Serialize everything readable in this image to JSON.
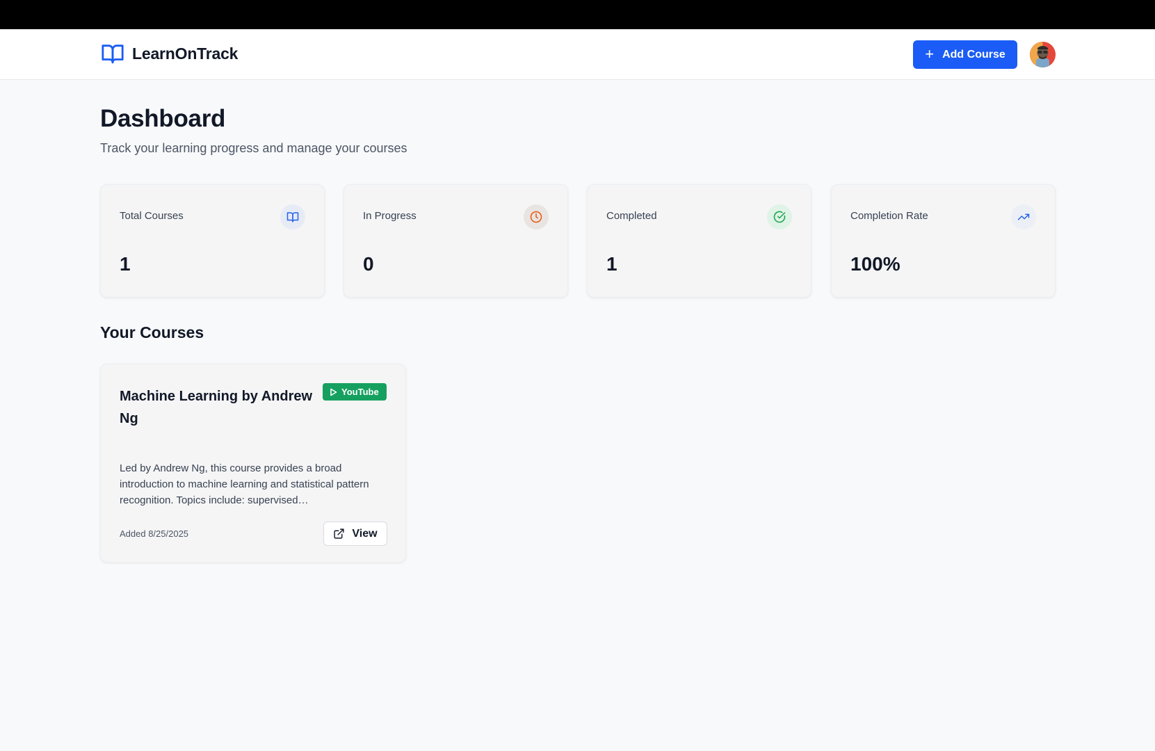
{
  "app": {
    "name": "LearnOnTrack",
    "logo_icon": "book-open-icon"
  },
  "header": {
    "add_course_label": "Add Course",
    "add_icon": "plus-icon",
    "avatar": "user-avatar"
  },
  "page": {
    "title": "Dashboard",
    "subtitle": "Track your learning progress and manage your courses"
  },
  "stats": [
    {
      "label": "Total Courses",
      "value": "1",
      "icon": "book-open-icon",
      "icon_color": "#2563eb",
      "icon_bg": "#e6ebf5"
    },
    {
      "label": "In Progress",
      "value": "0",
      "icon": "clock-icon",
      "icon_color": "#ea580c",
      "icon_bg": "#e8e4e2"
    },
    {
      "label": "Completed",
      "value": "1",
      "icon": "check-circle-icon",
      "icon_color": "#16a34a",
      "icon_bg": "#dff3e6"
    },
    {
      "label": "Completion Rate",
      "value": "100%",
      "icon": "trending-up-icon",
      "icon_color": "#2563eb",
      "icon_bg": "#eceff5"
    }
  ],
  "courses_section": {
    "title": "Your Courses"
  },
  "courses": [
    {
      "title": "Machine Learning by Andrew Ng",
      "source": "YouTube",
      "source_color": "#16a05f",
      "description": "Led by Andrew Ng, this course provides a broad introduction to machine learning and statistical pattern recognition. Topics include: supervised…",
      "added": "Added 8/25/2025",
      "view_label": "View"
    }
  ],
  "colors": {
    "primary": "#1a5cf5",
    "background": "#f8f9fb"
  }
}
